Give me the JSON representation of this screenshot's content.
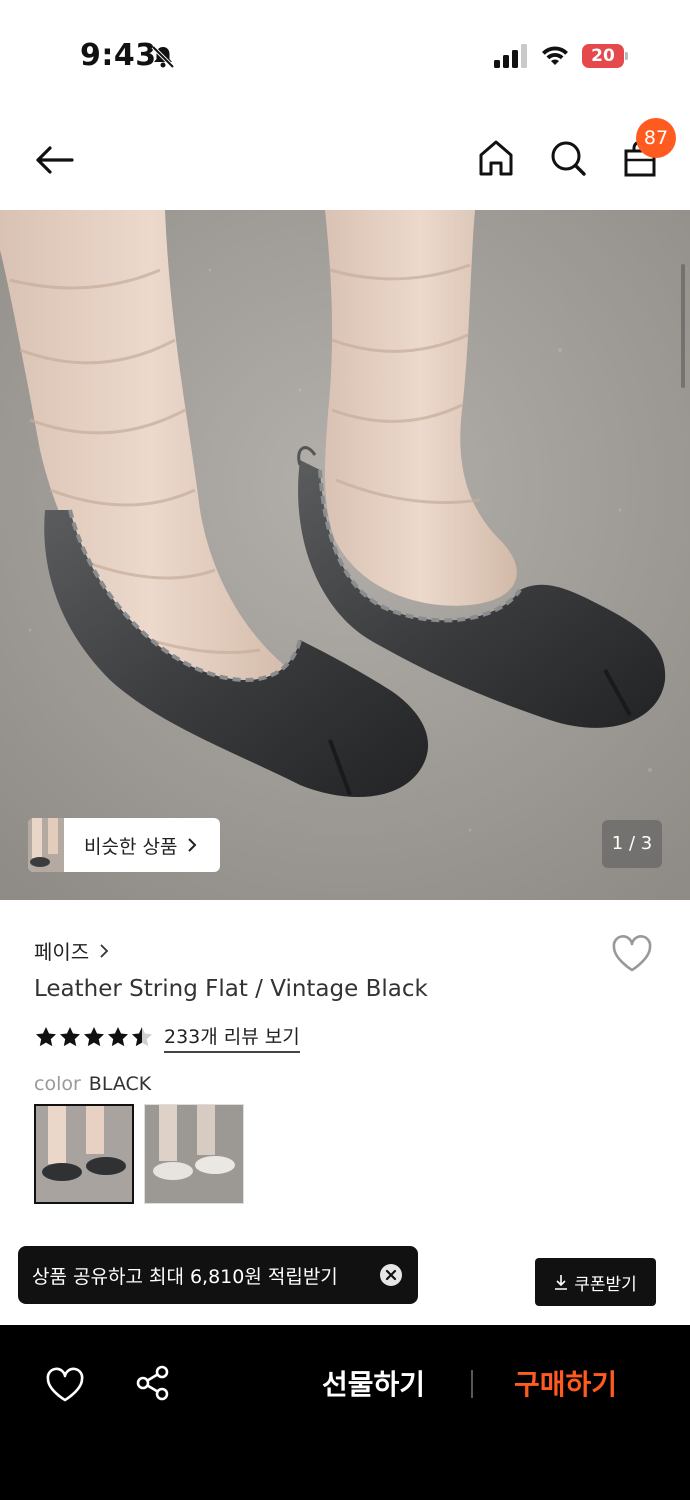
{
  "status_bar": {
    "time": "9:43",
    "battery": "20"
  },
  "header": {
    "cart_count": "87"
  },
  "product_image": {
    "similar_label": "비슷한 상품",
    "page_indicator": "1 / 3"
  },
  "product": {
    "brand": "페이즈",
    "title": "Leather String Flat / Vintage Black",
    "rating": 4.5,
    "review_link": "233개 리뷰 보기",
    "color_key": "color",
    "color_value": "BLACK"
  },
  "toast": {
    "text": "상품 공유하고 최대 6,810원 적립받기"
  },
  "coupon": {
    "label": "쿠폰받기"
  },
  "bottom_bar": {
    "gift_label": "선물하기",
    "buy_label": "구매하기"
  },
  "colors": {
    "accent": "#ff5a1f",
    "badge_bg": "#ff5a1f",
    "battery_low": "#e5484d",
    "bottom_bar_bg": "#000000"
  },
  "icons": [
    "bell-off-icon",
    "signal-icon",
    "wifi-icon",
    "back-arrow-icon",
    "home-icon",
    "search-icon",
    "bag-icon",
    "heart-icon",
    "share-icon",
    "close-icon",
    "download-icon",
    "star-icon"
  ]
}
